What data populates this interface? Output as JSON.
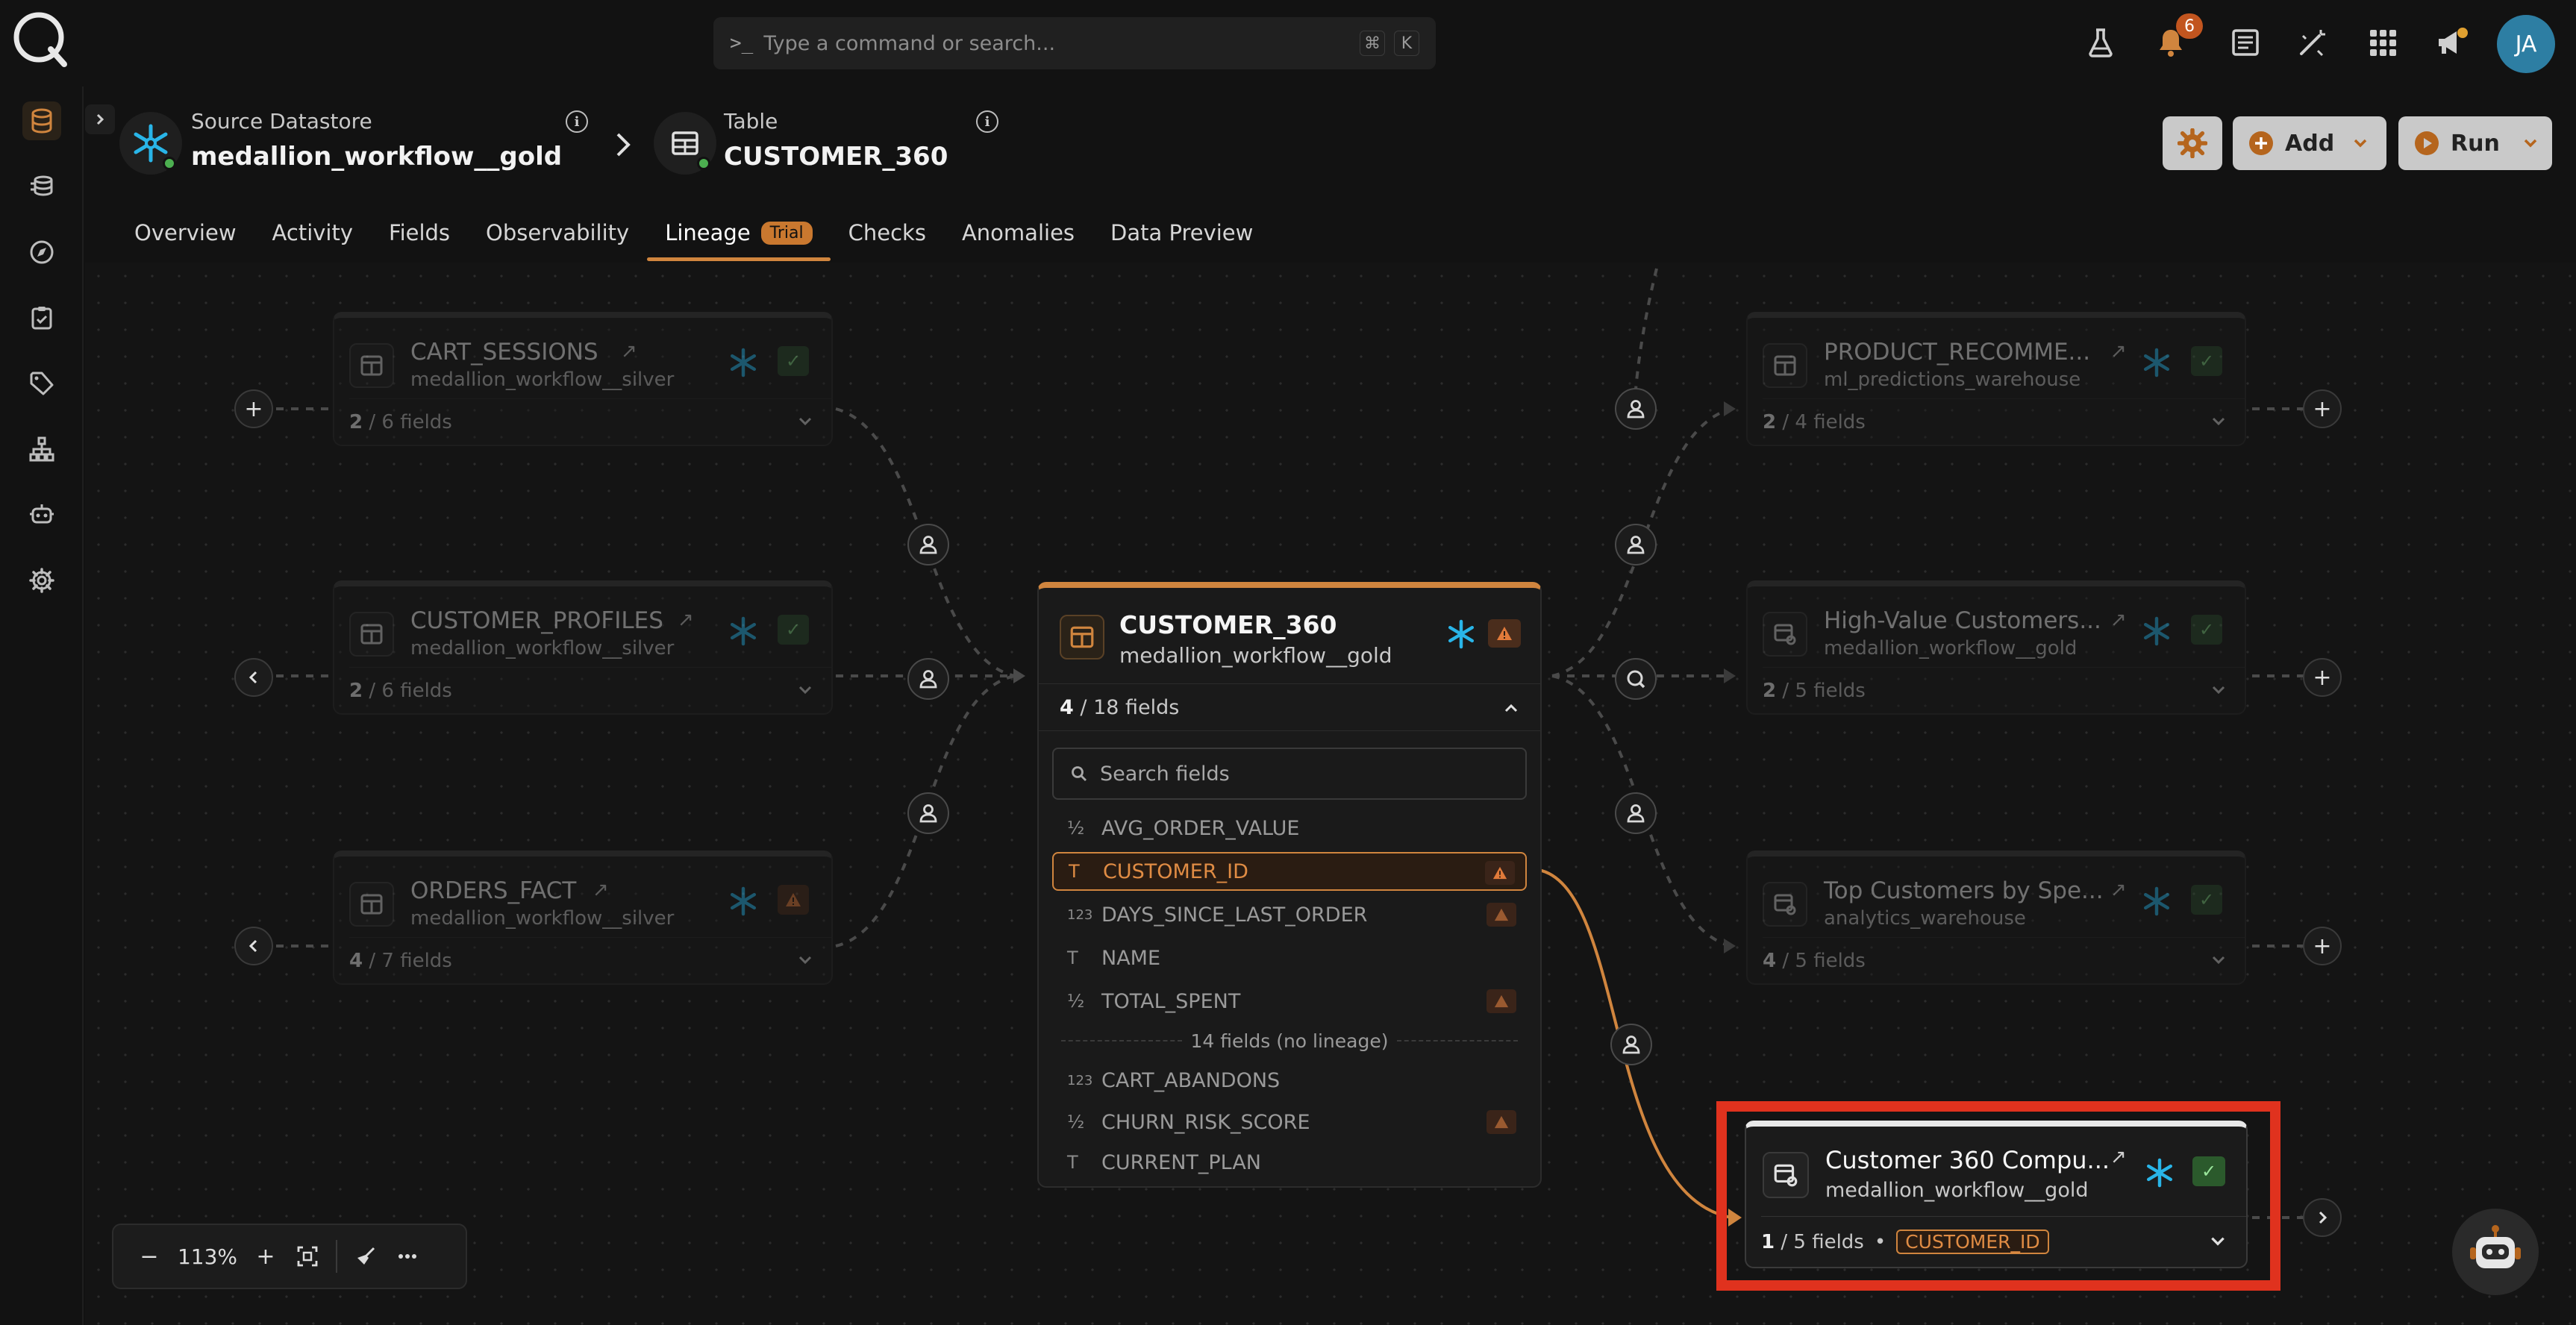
{
  "topbar": {
    "command_placeholder": "Type a command or search...",
    "shortcut_cmd": "⌘",
    "shortcut_key": "K",
    "notification_count": "6",
    "user_initials": "JA"
  },
  "header": {
    "datastore_label": "Source Datastore",
    "datastore_name": "medallion_workflow__gold",
    "table_label": "Table",
    "table_name": "CUSTOMER_360",
    "info_glyph": "i"
  },
  "actions": {
    "add_label": "Add",
    "run_label": "Run"
  },
  "tabs": [
    {
      "label": "Overview"
    },
    {
      "label": "Activity"
    },
    {
      "label": "Fields"
    },
    {
      "label": "Observability"
    },
    {
      "label": "Lineage",
      "badge": "Trial",
      "active": true
    },
    {
      "label": "Checks"
    },
    {
      "label": "Anomalies"
    },
    {
      "label": "Data Preview"
    }
  ],
  "upstream": [
    {
      "title": "CART_SESSIONS",
      "datastore": "medallion_workflow__silver",
      "fields_shown": "2",
      "fields_total": "/ 6 fields",
      "status": "ok"
    },
    {
      "title": "CUSTOMER_PROFILES",
      "datastore": "medallion_workflow__silver",
      "fields_shown": "2",
      "fields_total": "/ 6 fields",
      "status": "ok"
    },
    {
      "title": "ORDERS_FACT",
      "datastore": "medallion_workflow__silver",
      "fields_shown": "4",
      "fields_total": "/ 7 fields",
      "status": "warn"
    }
  ],
  "downstream": [
    {
      "title": "PRODUCT_RECOMME...",
      "datastore": "ml_predictions_warehouse",
      "fields_shown": "2",
      "fields_total": "/ 4 fields",
      "status": "ok"
    },
    {
      "title": "High-Value Customers...",
      "datastore": "medallion_workflow__gold",
      "fields_shown": "2",
      "fields_total": "/ 5 fields",
      "status": "ok"
    },
    {
      "title": "Top Customers by Spe...",
      "datastore": "analytics_warehouse",
      "fields_shown": "4",
      "fields_total": "/ 5 fields",
      "status": "ok"
    }
  ],
  "center": {
    "title": "CUSTOMER_360",
    "datastore": "medallion_workflow__gold",
    "fields_shown": "4",
    "fields_total": "/ 18 fields",
    "search_placeholder": "Search fields",
    "lineage_fields": [
      {
        "type": "½",
        "name": "AVG_ORDER_VALUE",
        "warn": false,
        "highlighted": false
      },
      {
        "type": "T",
        "name": "CUSTOMER_ID",
        "warn": true,
        "highlighted": true
      },
      {
        "type": "123",
        "name": "DAYS_SINCE_LAST_ORDER",
        "warn": true,
        "highlighted": false
      },
      {
        "type": "T",
        "name": "NAME",
        "warn": false,
        "highlighted": false
      },
      {
        "type": "½",
        "name": "TOTAL_SPENT",
        "warn": true,
        "highlighted": false
      }
    ],
    "no_lineage_label": "14 fields (no lineage)",
    "other_fields": [
      {
        "type": "123",
        "name": "CART_ABANDONS",
        "warn": false
      },
      {
        "type": "½",
        "name": "CHURN_RISK_SCORE",
        "warn": true
      },
      {
        "type": "T",
        "name": "CURRENT_PLAN",
        "warn": false
      }
    ]
  },
  "selected_node": {
    "title": "Customer 360 Compu...",
    "datastore": "medallion_workflow__gold",
    "fields_shown": "1",
    "fields_total": "/ 5 fields",
    "bullet": "•",
    "field_tag": "CUSTOMER_ID"
  },
  "zoom": {
    "value": "113%",
    "minus": "−",
    "plus": "+"
  },
  "colors": {
    "accent": "#d0853e",
    "highlight_box": "#e0321e",
    "ok": "#4caf50",
    "snowflake": "#29b5e8"
  }
}
